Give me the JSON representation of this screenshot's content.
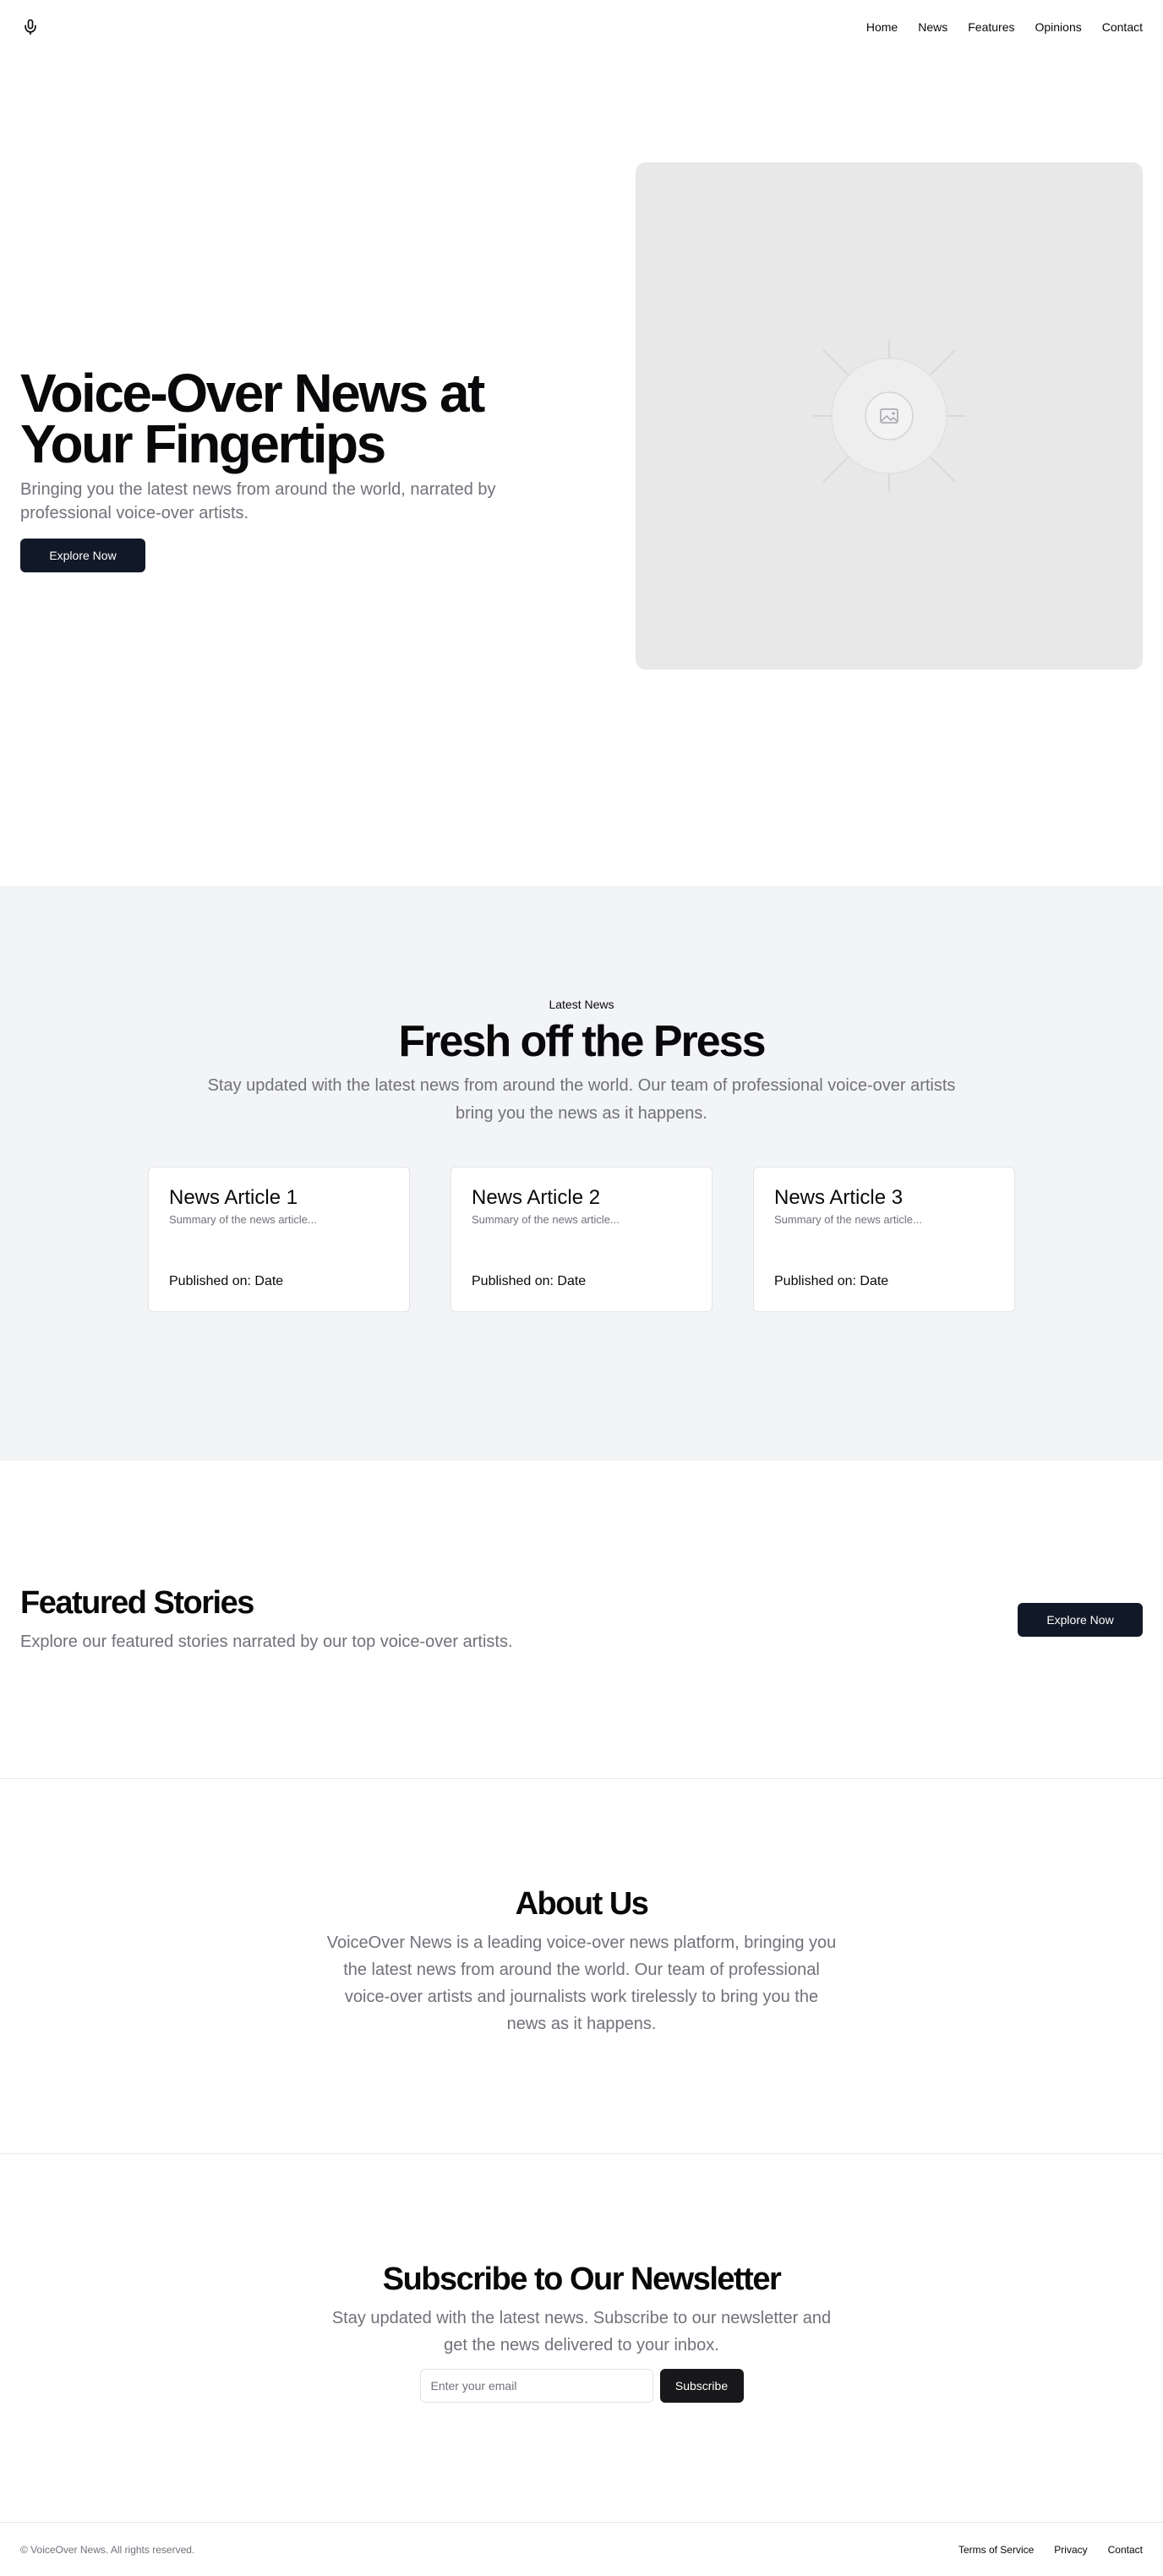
{
  "header": {
    "logo_icon": "microphone-icon",
    "nav": [
      "Home",
      "News",
      "Features",
      "Opinions",
      "Contact"
    ]
  },
  "hero": {
    "title": "Voice-Over News at Your Fingertips",
    "subtitle": "Bringing you the latest news from around the world, narrated by professional voice-over artists.",
    "cta": "Explore Now",
    "image_icon": "image-placeholder-icon"
  },
  "latest": {
    "eyebrow": "Latest News",
    "title": "Fresh off the Press",
    "subtitle": "Stay updated with the latest news from around the world. Our team of professional voice-over artists bring you the news as it happens.",
    "articles": [
      {
        "title": "News Article 1",
        "summary": "Summary of the news article...",
        "date": "Published on: Date"
      },
      {
        "title": "News Article 2",
        "summary": "Summary of the news article...",
        "date": "Published on: Date"
      },
      {
        "title": "News Article 3",
        "summary": "Summary of the news article...",
        "date": "Published on: Date"
      }
    ]
  },
  "featured": {
    "title": "Featured Stories",
    "subtitle": "Explore our featured stories narrated by our top voice-over artists.",
    "cta": "Explore Now"
  },
  "about": {
    "title": "About Us",
    "text": "VoiceOver News is a leading voice-over news platform, bringing you the latest news from around the world. Our team of professional voice-over artists and journalists work tirelessly to bring you the news as it happens."
  },
  "newsletter": {
    "title": "Subscribe to Our Newsletter",
    "subtitle": "Stay updated with the latest news. Subscribe to our newsletter and get the news delivered to your inbox.",
    "email_placeholder": "Enter your email",
    "email_value": "",
    "button": "Subscribe"
  },
  "footer": {
    "copyright": "© VoiceOver News. All rights reserved.",
    "links": [
      "Terms of Service",
      "Privacy",
      "Contact"
    ]
  }
}
